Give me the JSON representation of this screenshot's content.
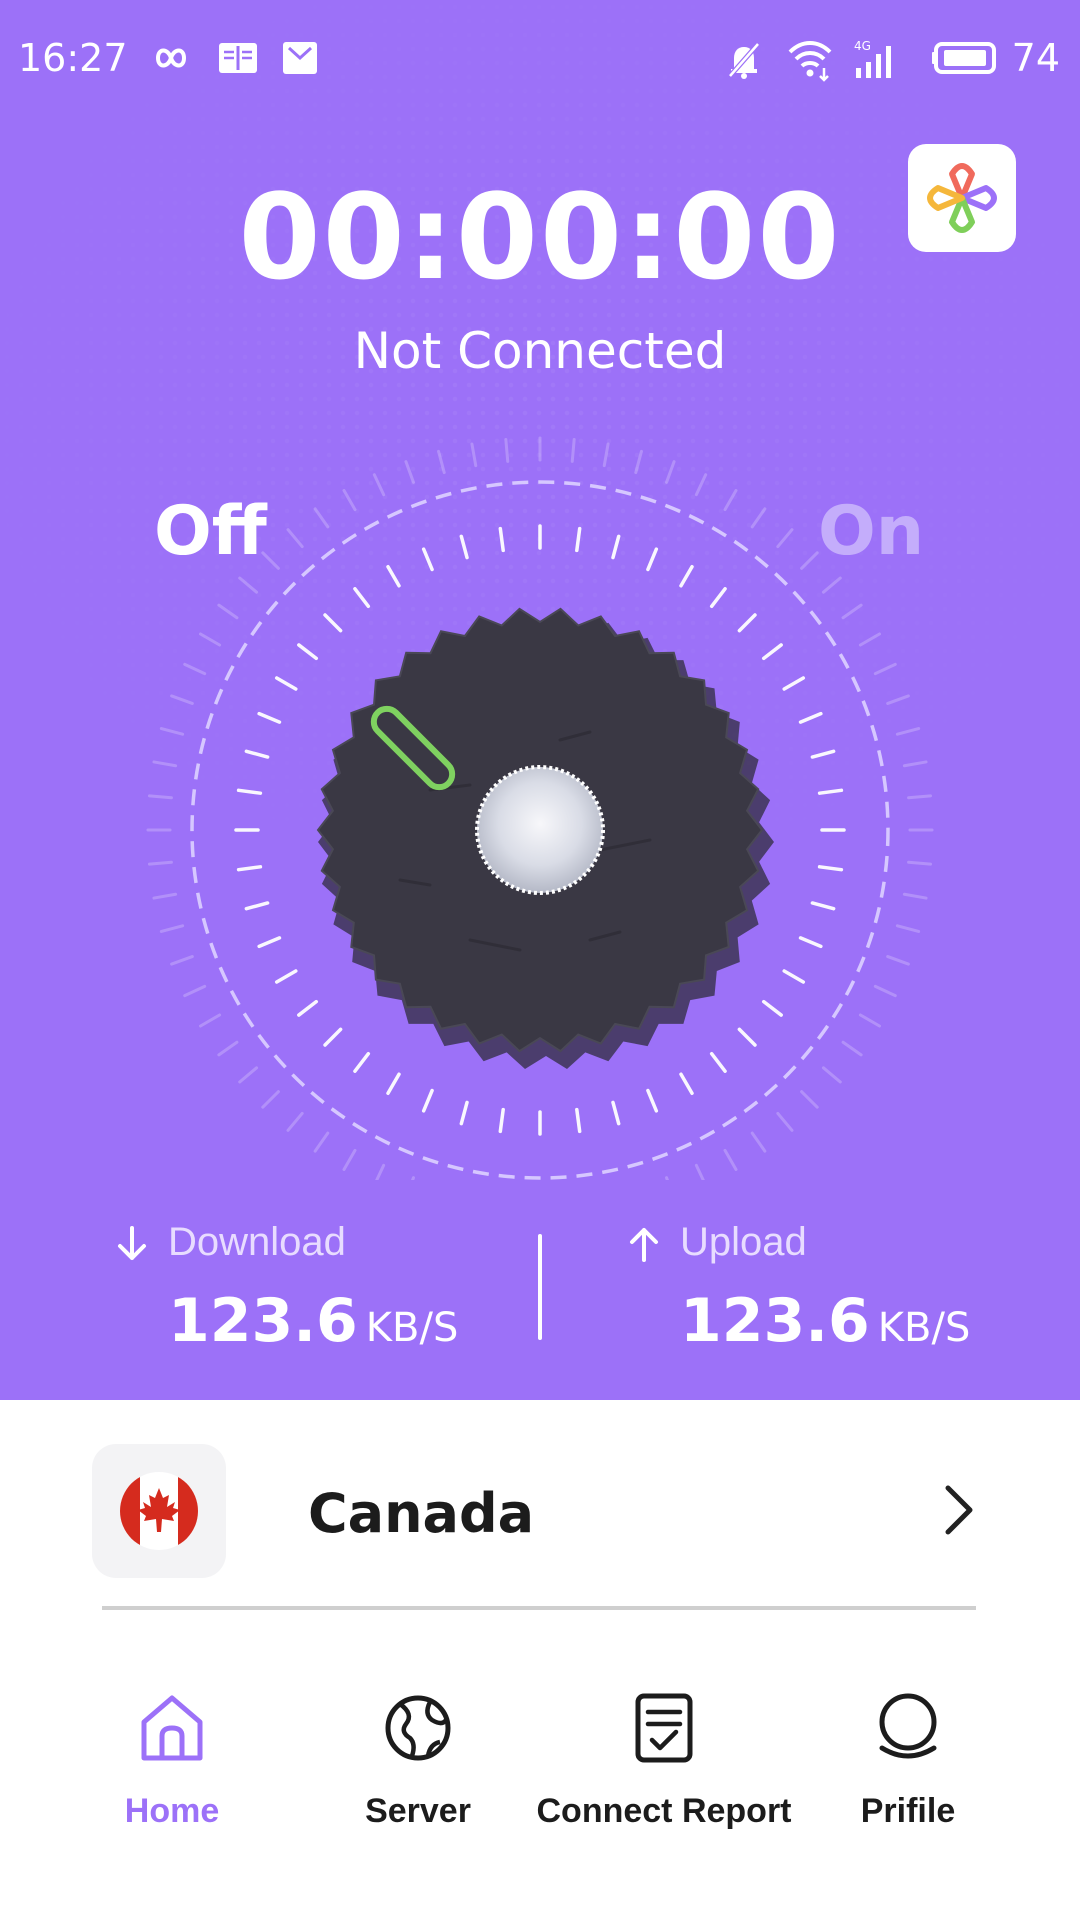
{
  "status_bar": {
    "time": "16:27",
    "battery": "74"
  },
  "timer": "00:00:00",
  "connection_status": "Not Connected",
  "switch": {
    "off_label": "Off",
    "on_label": "On",
    "state": "off"
  },
  "stats": {
    "download": {
      "label": "Download",
      "value": "123.6",
      "unit": "KB/S"
    },
    "upload": {
      "label": "Upload",
      "value": "123.6",
      "unit": "KB/S"
    }
  },
  "location": {
    "country": "Canada",
    "flag_icon": "canada-flag-icon"
  },
  "nav": {
    "items": [
      {
        "label": "Home",
        "icon": "home-icon",
        "active": true
      },
      {
        "label": "Server",
        "icon": "globe-icon",
        "active": false
      },
      {
        "label": "Connect Report",
        "icon": "report-icon",
        "active": false
      },
      {
        "label": "Prifile",
        "icon": "profile-icon",
        "active": false
      }
    ]
  },
  "colors": {
    "accent": "#9c71f8",
    "off_text": "#ffffff",
    "on_text": "#c4adfb",
    "knob": "#3a3844",
    "indicator": "#7fd160"
  }
}
